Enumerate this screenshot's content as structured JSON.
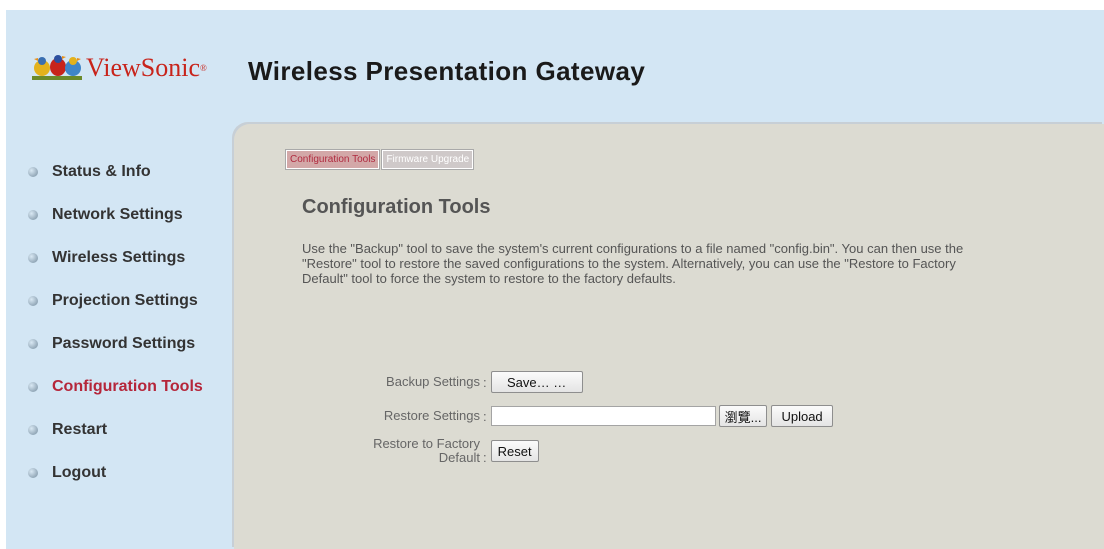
{
  "header": {
    "brand_name": "ViewSonic",
    "brand_mark": "®",
    "product_title": "Wireless Presentation Gateway"
  },
  "sidebar": {
    "items": [
      {
        "label": "Status & Info",
        "active": false
      },
      {
        "label": "Network Settings",
        "active": false
      },
      {
        "label": "Wireless Settings",
        "active": false
      },
      {
        "label": "Projection Settings",
        "active": false
      },
      {
        "label": "Password Settings",
        "active": false
      },
      {
        "label": "Configuration Tools",
        "active": true
      },
      {
        "label": "Restart",
        "active": false
      },
      {
        "label": "Logout",
        "active": false
      }
    ]
  },
  "tabs": [
    {
      "label": "Configuration Tools",
      "active": true
    },
    {
      "label": "Firmware Upgrade",
      "active": false
    }
  ],
  "main": {
    "title": "Configuration Tools",
    "description": "Use the \"Backup\" tool to save the system's current configurations to a file named \"config.bin\". You can then use the\n\"Restore\" tool to restore the saved configurations to the system. Alternatively, you can use the \"Restore to Factory\nDefault\" tool to force the system to restore to the factory defaults."
  },
  "form": {
    "backup_label": "Backup Settings",
    "save_button": "Save… …",
    "restore_label": "Restore Settings",
    "restore_file_value": "",
    "browse_button": "瀏覽...",
    "upload_button": "Upload",
    "factory_label_line1": "Restore to Factory",
    "factory_label_line2": "Default",
    "reset_button": "Reset",
    "colon": ":"
  },
  "colors": {
    "header_bg": "#d3e6f4",
    "content_bg": "#dcdbd2",
    "active_nav": "#b5263a",
    "brand": "#c8241b"
  }
}
